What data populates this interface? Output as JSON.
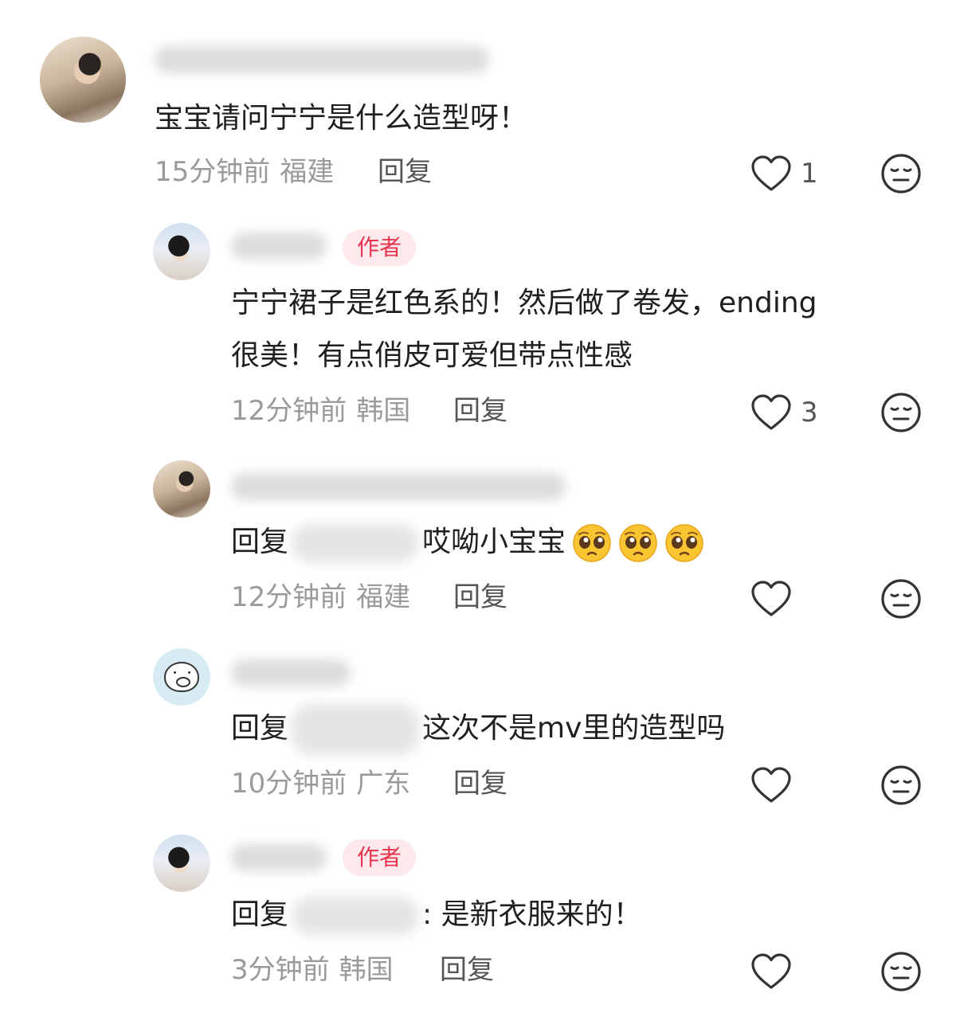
{
  "comments": [
    {
      "tag": "",
      "text": "宝宝请问宁宁是什么造型呀！",
      "reply_prefix": "",
      "time": "15分钟前",
      "location": "福建",
      "reply_label": "回复",
      "likes": "1"
    },
    {
      "tag": "作者",
      "text_line1": "宁宁裙子是红色系的！然后做了卷发，ending",
      "text_line2": "很美！有点俏皮可爱但带点性感",
      "time": "12分钟前",
      "location": "韩国",
      "reply_label": "回复",
      "likes": "3"
    },
    {
      "tag": "",
      "reply_prefix": "回复",
      "text": "哎呦小宝宝",
      "time": "12分钟前",
      "location": "福建",
      "reply_label": "回复",
      "likes": ""
    },
    {
      "tag": "",
      "reply_prefix": "回复",
      "text": "这次不是mv里的造型吗",
      "time": "10分钟前",
      "location": "广东",
      "reply_label": "回复",
      "likes": ""
    },
    {
      "tag": "作者",
      "reply_prefix": "回复",
      "text": ": 是新衣服来的！",
      "time": "3分钟前",
      "location": "韩国",
      "reply_label": "回复",
      "likes": ""
    }
  ],
  "icons": {
    "like": "heart-outline-icon",
    "dislike": "neutral-face-icon",
    "emoji": "pleading-face-emoji"
  },
  "colors": {
    "author_tag_bg": "#fde8ec",
    "author_tag_text": "#e8344e",
    "meta_text": "#9a9a9a"
  }
}
